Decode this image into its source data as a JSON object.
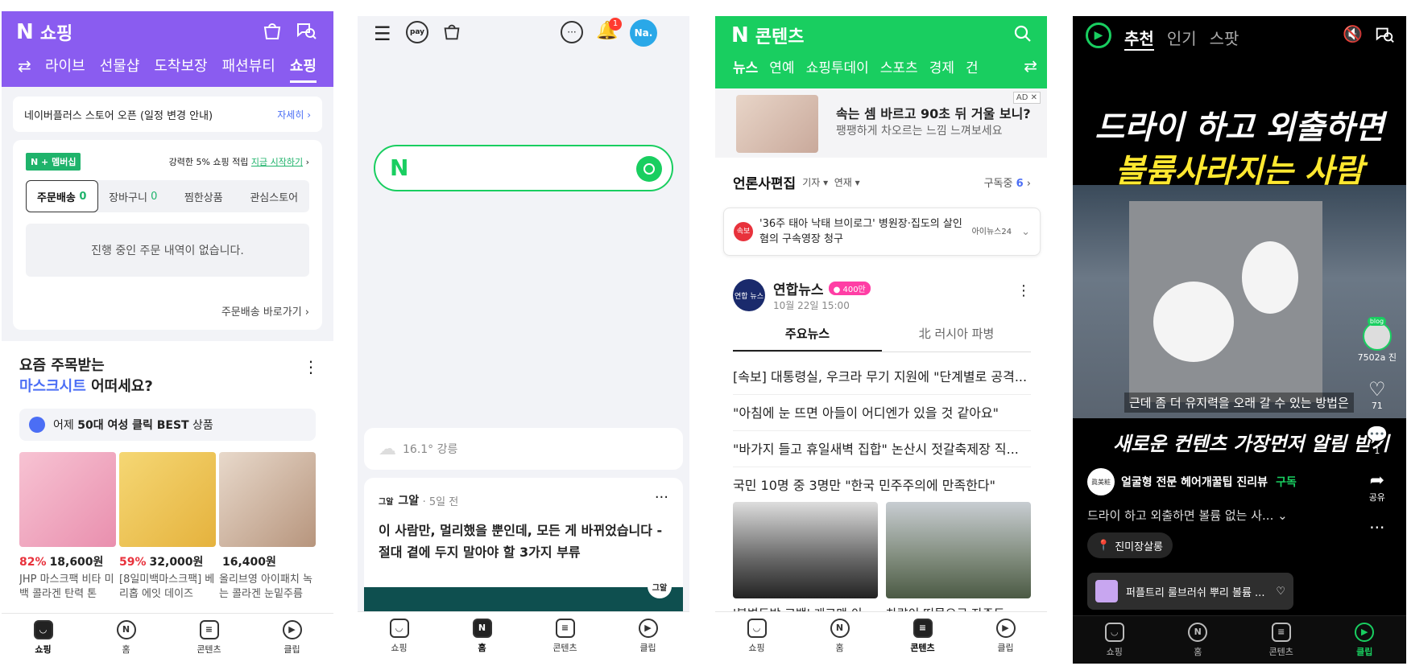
{
  "shopping": {
    "logo_n": "N",
    "title": "쇼핑",
    "tabs": [
      "라이브",
      "선물샵",
      "도착보장",
      "패션뷰티",
      "쇼핑"
    ],
    "notice": "네이버플러스 스토어 오픈 (일정 변경 안내)",
    "notice_link": "자세히",
    "membership_badge": "N + 멤버십",
    "membership_promo": "강력한 5% 쇼핑 적립",
    "membership_link": "지금 시작하기",
    "segments": [
      {
        "label": "주문배송",
        "count": "0"
      },
      {
        "label": "장바구니",
        "count": "0"
      },
      {
        "label": "찜한상품",
        "count": ""
      },
      {
        "label": "관심스토어",
        "count": ""
      }
    ],
    "empty_text": "진행 중인 주문 내역이 없습니다.",
    "goto_link": "주문배송 바로가기",
    "rec_title_1": "요즘 주목받는",
    "rec_title_blue": "마스크시트",
    "rec_title_2": "어떠세요?",
    "rec_chip_prefix": "어제",
    "rec_chip_bold": "50대 여성 클릭 BEST",
    "rec_chip_suffix": "상품",
    "products": [
      {
        "pct": "82%",
        "price": "18,600원",
        "name": "JHP 마스크팩 비타 미백 콜라겐 탄력 톤아..."
      },
      {
        "pct": "59%",
        "price": "32,000원",
        "name": "[8일미백마스크팩] 베리홉 에잇 데이즈 퓨..."
      },
      {
        "pct": "",
        "price": "16,400원",
        "name": "올리브영 아이패치 녹는 콜라겐 눈밑주름 ..."
      }
    ]
  },
  "home": {
    "pay_label": "pay",
    "notif_count": "1",
    "profile": "Na.",
    "search_n": "N",
    "weather": "16.1° 강릉",
    "feed_source_logo": "그알",
    "feed_source": "그알",
    "feed_time": "· 5일 전",
    "feed_title": "이 사람만, 멀리했을 뿐인데, 모든 게 바뀌었습니다 - 절대 곁에 두지 말아야 할 3가지 부류",
    "feed_media_badge": "그알"
  },
  "contents": {
    "logo_n": "N",
    "title": "콘텐츠",
    "tabs": [
      "뉴스",
      "연예",
      "쇼핑투데이",
      "스포츠",
      "경제",
      "건"
    ],
    "ad_title": "속는 셈 바르고 90초 뒤 거울 보니?",
    "ad_sub": "팽팽하게 차오르는 느낌 느껴보세요",
    "ad_tag": "AD ✕",
    "section_title": "언론사편집",
    "filter1": "기자 ▾",
    "filter2": "연재 ▾",
    "subscribed": "구독중",
    "subscribed_count": "6",
    "breaking_tag": "속보",
    "breaking_text": "'36주 태아 낙태 브이로그' 병원장·집도의 살인 혐의 구속영장 청구",
    "breaking_src": "아이뉴스24",
    "publisher_logo": "연합 뉴스",
    "publisher": "연합뉴스",
    "publisher_badge": "● 400만",
    "publisher_date": "10월 22일 15:00",
    "subtabs": [
      "주요뉴스",
      "北 러시아 파병"
    ],
    "headlines": [
      "[속보] 대통령실, 우크라 무기 지원에 \"단계별로 공격...",
      "\"아침에 눈 뜨면 아들이 어디엔가 있을 것 같아요\"",
      "\"바가지 들고 휴일새벽 집합\" 논산시 젓갈축제장 직...",
      "국민 10명 중 3명만 \"한국 민주주의에 만족한다\""
    ],
    "photo_captions": [
      "'북변도방 고백' 개그맨 이",
      "차량이 떠몰으로 자주도"
    ]
  },
  "clip": {
    "tabs": [
      "추천",
      "인기",
      "스팟"
    ],
    "headline_1": "드라이 하고 외출하면",
    "headline_2": "볼륨사라지는 사람",
    "subtitle": "근데 좀 더 유지력을 오래 갈 수 있는 방법은",
    "cta": "새로운 컨텐츠 가장먼저 알림 받기",
    "side_blog": "blog",
    "side_blog_label": "7502a 진",
    "likes": "71",
    "comments": "1",
    "share": "공유",
    "channel_avatar": "眞美粧",
    "channel": "얼굴형 전문 헤어개꿀팁 진리뷰",
    "subscribe": "구독",
    "desc": "드라이 하고 외출하면 볼륨 없는 사...",
    "location": "진미장살롱",
    "product": "퍼플트리 룰브러쉬 뿌리 볼륨 ..."
  },
  "nav": {
    "shopping": "쇼핑",
    "home": "홈",
    "contents": "콘텐츠",
    "clip": "클립"
  },
  "colors": {
    "shopping_purple": "#8a5cf0",
    "naver_green": "#19ce60",
    "sale_red": "#e8323c",
    "highlight_blue": "#4b6ef5"
  }
}
